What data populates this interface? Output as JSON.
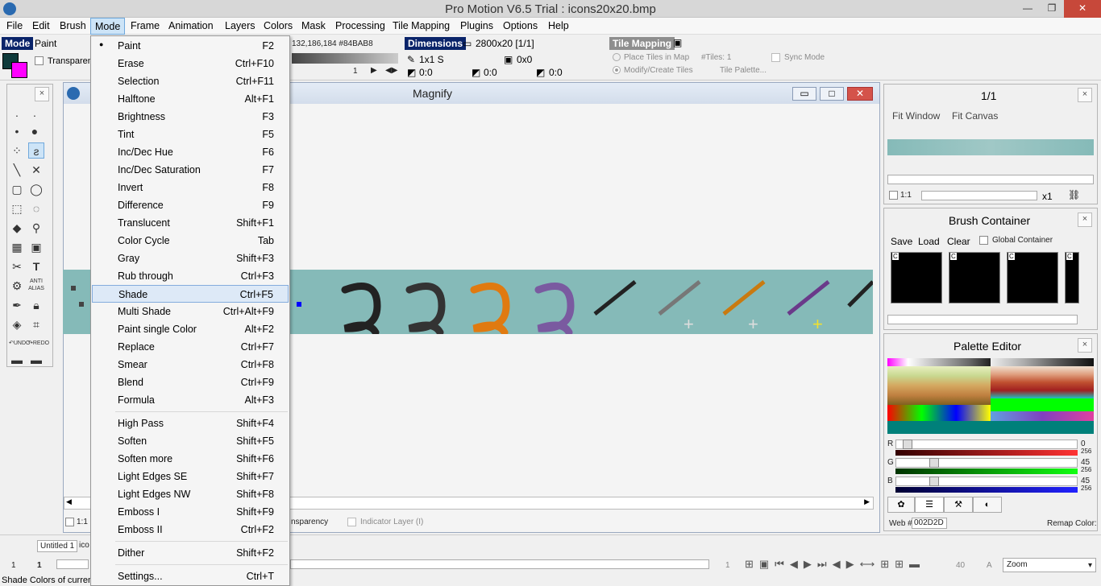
{
  "window": {
    "title": "Pro Motion V6.5 Trial : icons20x20.bmp",
    "min": "—",
    "restore": "❐",
    "close": "✕"
  },
  "menu": [
    "File",
    "Edit",
    "Brush",
    "Mode",
    "Frame",
    "Animation",
    "Layers",
    "Colors",
    "Mask",
    "Processing",
    "Tile Mapping",
    "Plugins",
    "Options",
    "Help"
  ],
  "mode_bar": {
    "label": "Mode",
    "value": "Paint",
    "transparent": "Transparent",
    "color_info": "132,186,184 #84BAB8",
    "spin": "1"
  },
  "dimensions": {
    "label": "Dimensions",
    "value": "2800x20 [1/1]",
    "brush": "1x1 S",
    "offset": "0x0",
    "a": "0:0",
    "b": "0:0",
    "c": "0:0"
  },
  "tile_mapping": {
    "label": "Tile Mapping",
    "place": "Place Tiles in Map",
    "modify": "Modify/Create Tiles",
    "tiles": "#Tiles: 1",
    "sync": "Sync Mode",
    "palette": "Tile Palette..."
  },
  "magnify": {
    "title": "Magnify",
    "transparency": "nsparency",
    "indicator": "Indicator Layer (I)"
  },
  "mode_menu": [
    {
      "label": "Paint",
      "shortcut": "F2",
      "checked": true
    },
    {
      "label": "Erase",
      "shortcut": "Ctrl+F10"
    },
    {
      "label": "Selection",
      "shortcut": "Ctrl+F11"
    },
    {
      "label": "Halftone",
      "shortcut": "Alt+F1"
    },
    {
      "label": "Brightness",
      "shortcut": "F3"
    },
    {
      "label": "Tint",
      "shortcut": "F5"
    },
    {
      "label": "Inc/Dec Hue",
      "shortcut": "F6"
    },
    {
      "label": "Inc/Dec Saturation",
      "shortcut": "F7"
    },
    {
      "label": "Invert",
      "shortcut": "F8"
    },
    {
      "label": "Difference",
      "shortcut": "F9"
    },
    {
      "label": "Translucent",
      "shortcut": "Shift+F1"
    },
    {
      "label": "Color Cycle",
      "shortcut": "Tab"
    },
    {
      "label": "Gray",
      "shortcut": "Shift+F3"
    },
    {
      "label": "Rub through",
      "shortcut": "Ctrl+F3"
    },
    {
      "label": "Shade",
      "shortcut": "Ctrl+F5",
      "highlight": true
    },
    {
      "label": "Multi Shade",
      "shortcut": "Ctrl+Alt+F9"
    },
    {
      "label": "Paint single Color",
      "shortcut": "Alt+F2"
    },
    {
      "label": "Replace",
      "shortcut": "Ctrl+F7"
    },
    {
      "label": "Smear",
      "shortcut": "Ctrl+F8"
    },
    {
      "label": "Blend",
      "shortcut": "Ctrl+F9"
    },
    {
      "label": "Formula",
      "shortcut": "Alt+F3"
    },
    {
      "sep": true
    },
    {
      "label": "High Pass",
      "shortcut": "Shift+F4"
    },
    {
      "label": "Soften",
      "shortcut": "Shift+F5"
    },
    {
      "label": "Soften more",
      "shortcut": "Shift+F6"
    },
    {
      "label": "Light Edges SE",
      "shortcut": "Shift+F7"
    },
    {
      "label": "Light Edges NW",
      "shortcut": "Shift+F8"
    },
    {
      "label": "Emboss I",
      "shortcut": "Shift+F9"
    },
    {
      "label": "Emboss II",
      "shortcut": "Ctrl+F2"
    },
    {
      "sep": true
    },
    {
      "label": "Dither",
      "shortcut": "Shift+F2"
    },
    {
      "sep": true
    },
    {
      "label": "Settings...",
      "shortcut": "Ctrl+T"
    }
  ],
  "preview": {
    "title": "1/1",
    "fit_window": "Fit Window",
    "fit_canvas": "Fit Canvas",
    "ratio": "1:1",
    "zoom": "x1"
  },
  "brush_container": {
    "title": "Brush Container",
    "save": "Save",
    "load": "Load",
    "clear": "Clear",
    "global": "Global Container",
    "slot": "C"
  },
  "palette_editor": {
    "title": "Palette Editor",
    "r": "R",
    "g": "G",
    "b": "B",
    "r_val": "0",
    "g_val": "45",
    "b_val": "45",
    "max": "256",
    "r_level": 0,
    "g_level": 0.176,
    "b_level": 0.176,
    "web_label": "Web #",
    "web_value": "002D2D",
    "remap": "Remap Color:"
  },
  "status": {
    "tab1": "Untitled 1",
    "tab2": "ico",
    "frame_a": "1",
    "frame_b": "1",
    "frame_c": "1",
    "count": "40",
    "a": "A",
    "zoom": "Zoom",
    "hint": "Shade Colors of curren"
  },
  "colors": {
    "accent_menu": "#cde4f7",
    "fg": "#0f3a3a",
    "bg": "#ff00ff",
    "strip": "#85bab8"
  }
}
